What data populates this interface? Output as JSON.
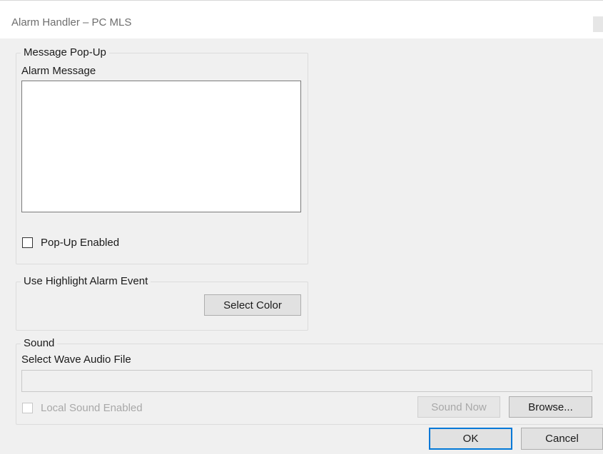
{
  "window": {
    "title": "Alarm Handler –  PC MLS"
  },
  "message_popup": {
    "group_label": "Message Pop-Up",
    "alarm_message_label": "Alarm Message",
    "alarm_message_value": "",
    "popup_enabled_label": "Pop-Up Enabled",
    "popup_enabled_checked": false
  },
  "highlight": {
    "group_label": "Use Highlight Alarm Event",
    "select_color_label": "Select Color"
  },
  "sound": {
    "group_label": "Sound",
    "wave_file_label": "Select Wave Audio File",
    "wave_file_value": "",
    "local_sound_label": "Local Sound Enabled",
    "local_sound_checked": false,
    "sound_now_label": "Sound Now",
    "browse_label": "Browse..."
  },
  "footer": {
    "ok_label": "OK",
    "cancel_label": "Cancel"
  },
  "colors": {
    "focus_border": "#0078d7",
    "disabled_text": "#a8a8a8"
  }
}
